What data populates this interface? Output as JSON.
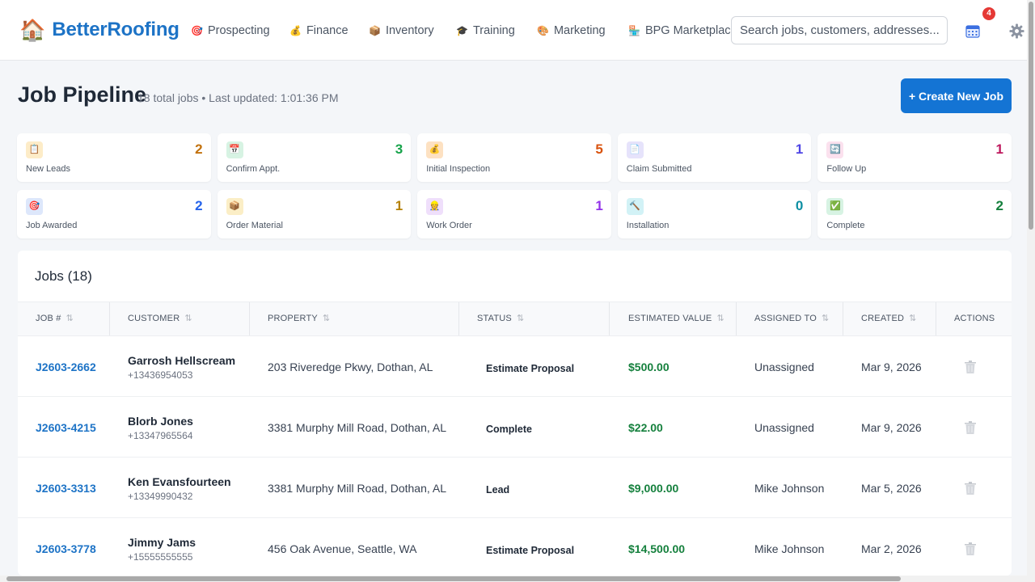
{
  "brand": {
    "name": "BetterRoofing",
    "icon": "house-emoji"
  },
  "nav": [
    {
      "label": "Prospecting",
      "icon": "🎯"
    },
    {
      "label": "Finance",
      "icon": "💰"
    },
    {
      "label": "Inventory",
      "icon": "📦"
    },
    {
      "label": "Training",
      "icon": "🎓"
    },
    {
      "label": "Marketing",
      "icon": "🎨"
    },
    {
      "label": "BPG Marketplace",
      "icon": "🏪"
    }
  ],
  "search": {
    "placeholder": "Search jobs, customers, addresses..."
  },
  "notifications": {
    "count": "4"
  },
  "header": {
    "title": "Job Pipeline",
    "subtitle": "18 total jobs • Last updated: 1:01:36 PM",
    "create_label": "+ Create New Job"
  },
  "stages": [
    {
      "label": "New Leads",
      "count": "2",
      "icon": "📋",
      "color": "#c2710c",
      "bg": "#fdecc8"
    },
    {
      "label": "Confirm Appt.",
      "count": "3",
      "icon": "📅",
      "color": "#16a34a",
      "bg": "#d7f3e3"
    },
    {
      "label": "Initial Inspection",
      "count": "5",
      "icon": "💰",
      "color": "#d9530f",
      "bg": "#fde1c2"
    },
    {
      "label": "Claim Submitted",
      "count": "1",
      "icon": "📄",
      "color": "#4f46e5",
      "bg": "#e6e3fb"
    },
    {
      "label": "Follow Up",
      "count": "1",
      "icon": "🔄",
      "color": "#be185d",
      "bg": "#fbe1ee"
    },
    {
      "label": "Job Awarded",
      "count": "2",
      "icon": "🎯",
      "color": "#2563eb",
      "bg": "#dde7fb"
    },
    {
      "label": "Order Material",
      "count": "1",
      "icon": "📦",
      "color": "#b58105",
      "bg": "#fbeec6"
    },
    {
      "label": "Work Order",
      "count": "1",
      "icon": "👷",
      "color": "#9333ea",
      "bg": "#efdffb"
    },
    {
      "label": "Installation",
      "count": "0",
      "icon": "🔨",
      "color": "#0e8fa3",
      "bg": "#d2f2f6"
    },
    {
      "label": "Complete",
      "count": "2",
      "icon": "✅",
      "color": "#15803d",
      "bg": "#d7f3e3"
    }
  ],
  "jobs": {
    "title": "Jobs (18)",
    "columns": [
      "JOB #",
      "CUSTOMER",
      "PROPERTY",
      "STATUS",
      "ESTIMATED VALUE",
      "ASSIGNED TO",
      "CREATED",
      "ACTIONS"
    ],
    "rows": [
      {
        "job": "J2603-2662",
        "name": "Garrosh Hellscream",
        "phone": "+13436954053",
        "property": "203 Riveredge Pkwy, Dothan, AL",
        "status": "Estimate Proposal",
        "value": "$500.00",
        "assigned": "Unassigned",
        "created": "Mar 9, 2026"
      },
      {
        "job": "J2603-4215",
        "name": "Blorb Jones",
        "phone": "+13347965564",
        "property": "3381 Murphy Mill Road, Dothan, AL",
        "status": "Complete",
        "value": "$22.00",
        "assigned": "Unassigned",
        "created": "Mar 9, 2026"
      },
      {
        "job": "J2603-3313",
        "name": "Ken Evansfourteen",
        "phone": "+13349990432",
        "property": "3381 Murphy Mill Road, Dothan, AL",
        "status": "Lead",
        "value": "$9,000.00",
        "assigned": "Mike Johnson",
        "created": "Mar 5, 2026"
      },
      {
        "job": "J2603-3778",
        "name": "Jimmy Jams",
        "phone": "+15555555555",
        "property": "456 Oak Avenue, Seattle, WA",
        "status": "Estimate Proposal",
        "value": "$14,500.00",
        "assigned": "Mike Johnson",
        "created": "Mar 2, 2026"
      }
    ]
  }
}
